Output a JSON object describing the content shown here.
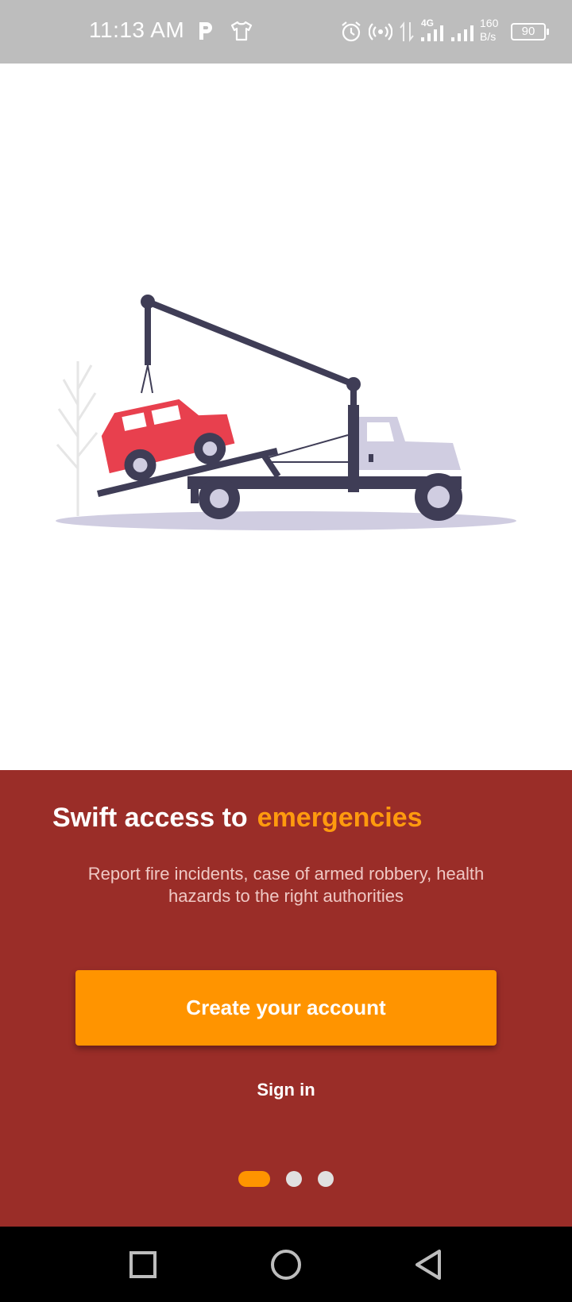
{
  "status_bar": {
    "time": "11:13 AM",
    "network_type": "4G",
    "speed_value": "160",
    "speed_unit": "B/s",
    "battery": "90",
    "icons": [
      "p-app-icon",
      "shirt-icon",
      "alarm-icon",
      "hotspot-icon",
      "data-arrows-icon",
      "signal-icon",
      "signal-icon",
      "battery-icon"
    ]
  },
  "illustration": {
    "subject": "tow-truck-lifting-car",
    "colors": {
      "car": "#e8404e",
      "truck_dark": "#3f3d56",
      "truck_light": "#d0cde1",
      "ground": "#d0cde1",
      "tree": "#e6e6e6"
    }
  },
  "onboarding": {
    "headline_prefix": "Swift access to",
    "headline_accent": "emergencies",
    "subtitle": "Report fire incidents, case of armed robbery, health hazards to the right authorities",
    "primary_button": "Create your account",
    "secondary_button": "Sign in",
    "page_count": 3,
    "active_page": 1
  },
  "colors": {
    "panel_bg": "#9a2d28",
    "accent": "#ff9400",
    "status_bar_bg": "#bdbdbd"
  },
  "nav_bar": {
    "buttons": [
      "recents-button",
      "home-button",
      "back-button"
    ]
  }
}
